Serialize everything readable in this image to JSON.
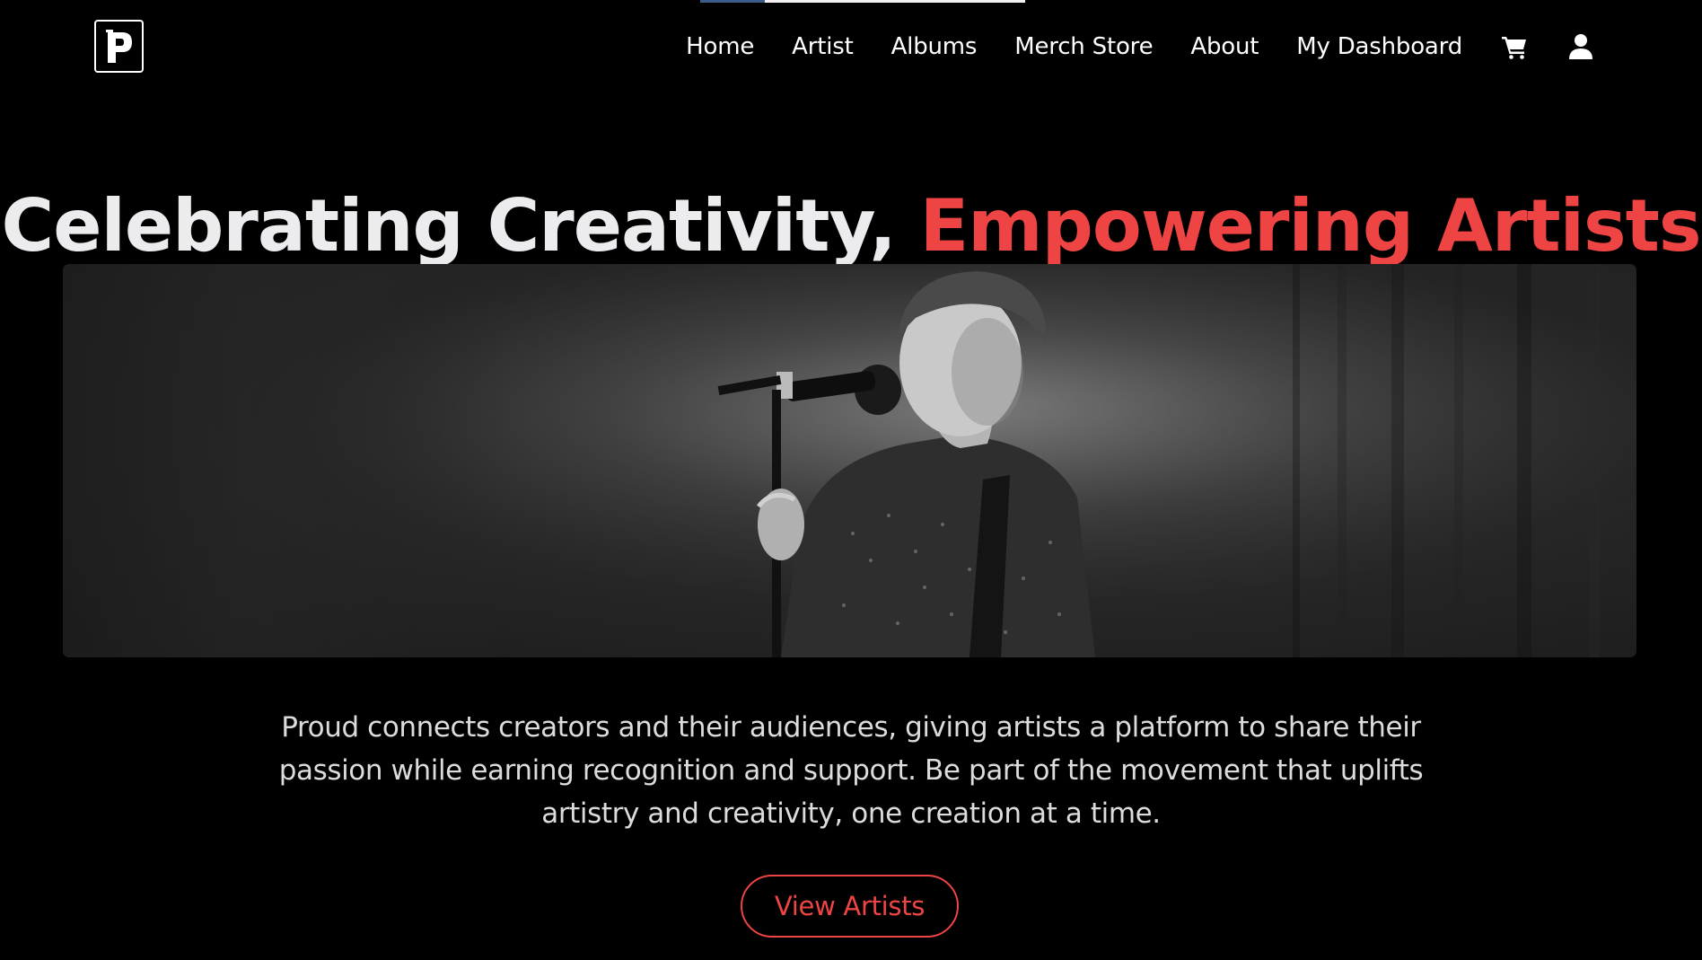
{
  "nav": {
    "logo_letter": "P",
    "links": [
      "Home",
      "Artist",
      "Albums",
      "Merch Store",
      "About",
      "My Dashboard"
    ],
    "cart_icon": "cart-icon",
    "user_icon": "user-icon"
  },
  "hero": {
    "title_part1": "Celebrating Creativity, ",
    "title_part2": "Empowering Artists",
    "image_alt": "singer-at-microphone-photo",
    "description": "Proud connects creators and their audiences, giving artists a platform to share their passion while earning recognition and support. Be part of the movement that uplifts artistry and creativity, one creation at a time.",
    "cta_label": "View Artists"
  },
  "colors": {
    "background": "#000000",
    "accent": "#ef4444",
    "title_light": "#ececef",
    "text": "#dcdcdc"
  }
}
